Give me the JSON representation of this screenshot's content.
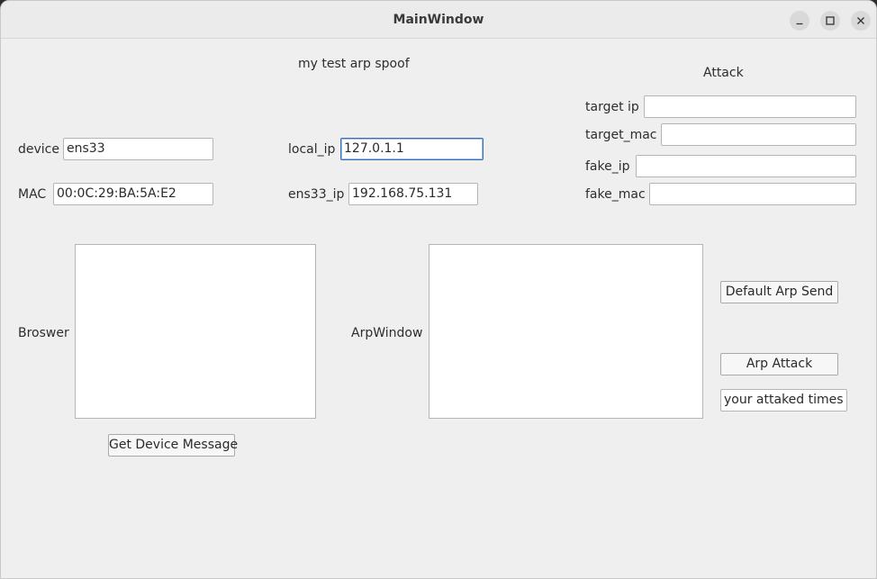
{
  "window": {
    "title": "MainWindow",
    "controls": {
      "minimize_icon": "minimize-icon",
      "maximize_icon": "maximize-icon",
      "close_icon": "close-icon"
    }
  },
  "header": {
    "heading": "my test arp spoof",
    "attack_heading": "Attack"
  },
  "device_info": {
    "device_label": "device",
    "device_value": "ens33",
    "mac_label": "MAC",
    "mac_value": "00:0C:29:BA:5A:E2",
    "local_ip_label": "local_ip",
    "local_ip_value": "127.0.1.1",
    "iface_ip_label": "ens33_ip",
    "iface_ip_value": "192.168.75.131"
  },
  "attack": {
    "target_ip_label": "target ip",
    "target_ip_value": "",
    "target_mac_label": "target_mac",
    "target_mac_value": "",
    "fake_ip_label": "fake_ip",
    "fake_ip_value": "",
    "fake_mac_label": "fake_mac",
    "fake_mac_value": ""
  },
  "panels": {
    "browser_label": "Broswer",
    "arp_window_label": "ArpWindow"
  },
  "buttons": {
    "get_device_message": "Get Device Message",
    "default_arp_send": "Default Arp Send",
    "arp_attack": "Arp Attack"
  },
  "counter": {
    "text": "your attaked times"
  }
}
